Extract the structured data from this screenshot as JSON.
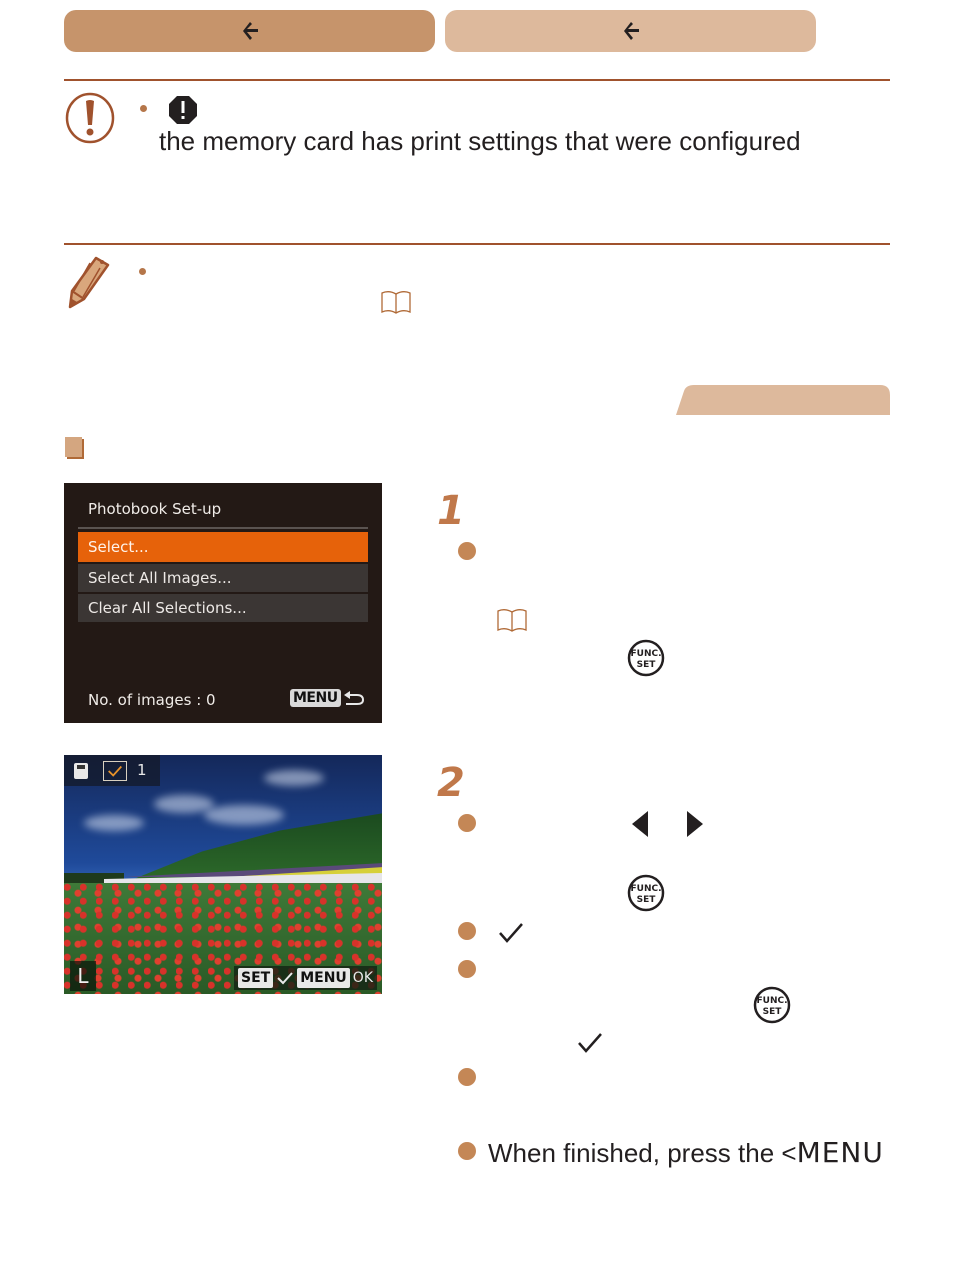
{
  "nav": {
    "prev_icon": "arrow-left-icon",
    "next_icon": "arrow-left-icon",
    "prev_color": "#c6946b",
    "next_color": "#ddb99c"
  },
  "caution": {
    "icon": "caution-exclamation-icon",
    "inline_icon": "stop-warning-icon",
    "text": "the memory card has print settings that were configured"
  },
  "note": {
    "icon": "pencil-icon",
    "ref_icon": "book-reference-icon"
  },
  "section": {
    "marker_icon": "section-square-icon"
  },
  "camera_menu": {
    "title": "Photobook Set-up",
    "items": [
      {
        "label": "Select...",
        "selected": true
      },
      {
        "label": "Select All Images...",
        "selected": false
      },
      {
        "label": "Clear All Selections...",
        "selected": false
      }
    ],
    "footer": "No. of images : 0",
    "menu_badge": "MENU",
    "return_icon": "return-arrow-icon"
  },
  "photo_screen": {
    "count": "1",
    "size_label": "L",
    "set_badge": "SET",
    "menu_badge": "MENU",
    "ok_label": "OK"
  },
  "steps": [
    {
      "number": "1"
    },
    {
      "number": "2",
      "final_text": "When finished, press the <",
      "final_menu": "MENU"
    }
  ],
  "colors": {
    "accent": "#c48756",
    "rule": "#a0522d",
    "menu_selected": "#e6620a"
  }
}
